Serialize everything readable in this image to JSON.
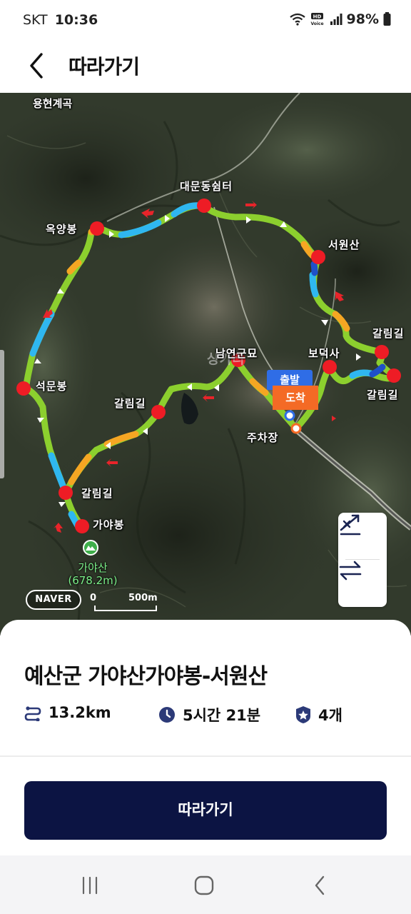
{
  "status": {
    "carrier": "SKT",
    "time": "10:36",
    "network_badge": "HD Voice",
    "battery": "98%",
    "icons": [
      "wifi-icon",
      "hd-voice-icon",
      "signal-icon",
      "battery-icon"
    ]
  },
  "header": {
    "title": "따라가기",
    "back_icon": "chevron-left-icon"
  },
  "map": {
    "labels": {
      "valley": "용현계곡",
      "daemun": "대문동쉼터",
      "okyang": "옥양봉",
      "seowon": "서원산",
      "galrim_east": "갈림길",
      "bodeok": "보덕사",
      "galrim_east2": "갈림길",
      "namyeon": "남연군묘",
      "town": "상가리",
      "seokmun": "석문봉",
      "galrim_mid": "갈림길",
      "parking": "주차장",
      "galrim_west": "갈림길",
      "gaya_peak": "가야봉"
    },
    "start_tag": "출발",
    "end_tag": "도착",
    "mountain_name": "가야산",
    "mountain_elevation": "(678.2m)",
    "provider": "NAVER",
    "scale_zero": "0",
    "scale_length": "500m",
    "controls": [
      "route-toggle-icon",
      "swap-direction-icon"
    ],
    "colors": {
      "route_green": "#8ccf2e",
      "route_blue": "#2fb7f0",
      "route_orange": "#f5a623",
      "waypoint_red": "#ee1c25",
      "arrow_red": "#e8242a"
    }
  },
  "course": {
    "title": "예산군 가야산가야봉-서원산",
    "distance": "13.2km",
    "duration": "5시간 21분",
    "waypoint_count": "4개",
    "follow_label": "따라가기"
  },
  "navbar": {
    "icons": [
      "recent-apps-icon",
      "home-icon",
      "back-icon"
    ]
  }
}
